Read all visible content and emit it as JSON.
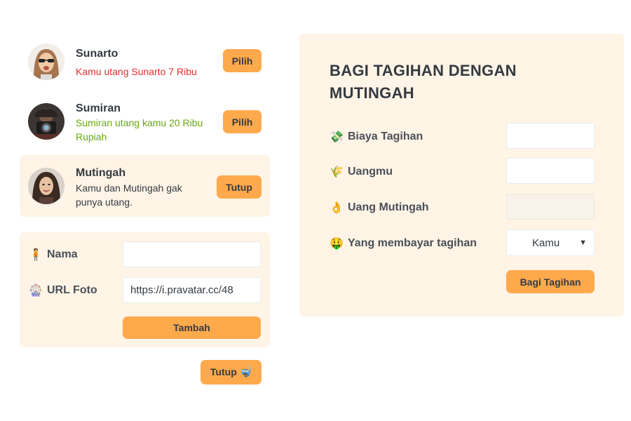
{
  "friends": [
    {
      "name": "Sunarto",
      "status": "Kamu utang Sunarto 7 Ribu",
      "button": "Pilih"
    },
    {
      "name": "Sumiran",
      "status": "Sumiran utang kamu 20 Ribu Rupiah",
      "button": "Pilih"
    },
    {
      "name": "Mutingah",
      "status": "Kamu dan Mutingah gak punya utang.",
      "button": "Tutup"
    }
  ],
  "add_form": {
    "name_icon": "🧍",
    "name_label": "Nama",
    "name_value": "",
    "url_icon": "🎡",
    "url_label": "URL Foto",
    "url_value": "https://i.pravatar.cc/48",
    "submit_label": "Tambah"
  },
  "close_button": "Tutup 🤿",
  "split_form": {
    "title": "BAGI TAGIHAN DENGAN MUTINGAH",
    "bill_icon": "💸",
    "bill_label": "Biaya Tagihan",
    "bill_value": "",
    "yours_icon": "🌾",
    "yours_label": "Uangmu",
    "yours_value": "",
    "friend_icon": "👌",
    "friend_label": "Uang Mutingah",
    "friend_value": "",
    "payer_icon": "🤑",
    "payer_label": "Yang membayar tagihan",
    "payer_selected": "Kamu",
    "submit_label": "Bagi Tagihan"
  },
  "colors": {
    "accent": "#ffa94d",
    "panel": "#fff4e6",
    "owe_red": "#e03131",
    "owed_green": "#66a80f"
  }
}
